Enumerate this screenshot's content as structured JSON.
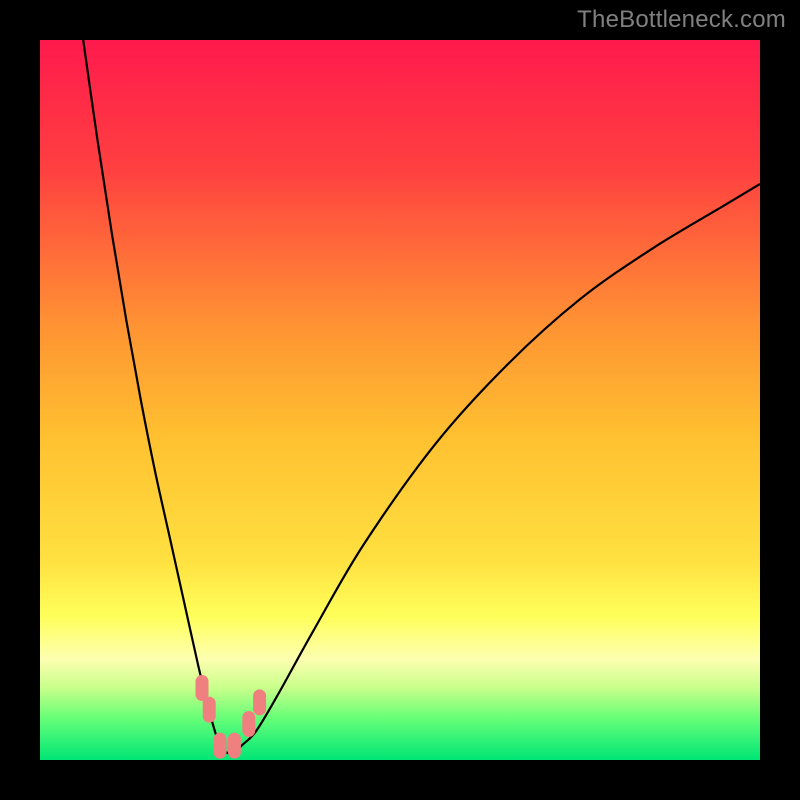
{
  "watermark": "TheBottleneck.com",
  "colors": {
    "frame": "#000000",
    "curve": "#000000",
    "marker_fill": "#f08080",
    "marker_stroke": "#c04040",
    "gradient_stops": [
      {
        "offset": 0.0,
        "color": "#ff1a4d"
      },
      {
        "offset": 0.18,
        "color": "#ff4040"
      },
      {
        "offset": 0.4,
        "color": "#ff9433"
      },
      {
        "offset": 0.55,
        "color": "#ffc030"
      },
      {
        "offset": 0.72,
        "color": "#ffe040"
      },
      {
        "offset": 0.8,
        "color": "#ffff5a"
      },
      {
        "offset": 0.86,
        "color": "#fdffb0"
      },
      {
        "offset": 0.9,
        "color": "#c8ff8a"
      },
      {
        "offset": 0.94,
        "color": "#6aff78"
      },
      {
        "offset": 1.0,
        "color": "#00e676"
      }
    ]
  },
  "chart_data": {
    "type": "line",
    "title": "",
    "xlabel": "",
    "ylabel": "",
    "xlim": [
      0,
      100
    ],
    "ylim": [
      0,
      100
    ],
    "grid": false,
    "legend": "none",
    "series": [
      {
        "name": "bottleneck-curve",
        "x": [
          6,
          8,
          10,
          12,
          14,
          16,
          18,
          20,
          22,
          23,
          24,
          25,
          26,
          27,
          28,
          30,
          33,
          38,
          45,
          55,
          65,
          75,
          85,
          95,
          100
        ],
        "y": [
          100,
          86,
          73,
          61,
          50,
          40,
          31,
          22,
          13,
          9,
          5,
          2,
          1,
          1,
          2,
          4,
          9,
          18,
          30,
          44,
          55,
          64,
          71,
          77,
          80
        ]
      }
    ],
    "markers": [
      {
        "x": 22.5,
        "y": 10,
        "name": "left-upper-marker"
      },
      {
        "x": 23.5,
        "y": 7,
        "name": "left-lower-marker"
      },
      {
        "x": 25.0,
        "y": 2,
        "name": "bottom-left-marker"
      },
      {
        "x": 27.0,
        "y": 2,
        "name": "bottom-right-marker"
      },
      {
        "x": 29.0,
        "y": 5,
        "name": "right-lower-marker"
      },
      {
        "x": 30.5,
        "y": 8,
        "name": "right-upper-marker"
      }
    ]
  }
}
